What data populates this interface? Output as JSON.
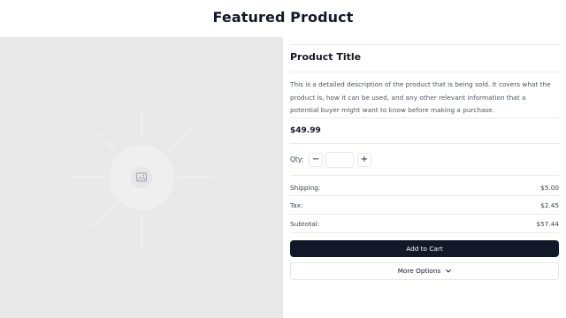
{
  "header": {
    "title": "Featured Product"
  },
  "product": {
    "title": "Product Title",
    "description": "This is a detailed description of the product that is being sold. It covers what the product is, how it can be used, and any other relevant information that a potential buyer might want to know before making a purchase.",
    "price": "$49.99"
  },
  "quantity": {
    "label": "Qty:",
    "decrement": "−",
    "increment": "+",
    "value": ""
  },
  "costs": [
    {
      "label": "Shipping:",
      "value": "$5.00"
    },
    {
      "label": "Tax:",
      "value": "$2.45"
    },
    {
      "label": "Subtotal:",
      "value": "$57.44"
    }
  ],
  "actions": {
    "add_to_cart": "Add to Cart",
    "more_options": "More Options"
  },
  "icons": {
    "image_placeholder": "image-icon",
    "more_options": "chevron-down-icon"
  },
  "colors": {
    "primary_button": "#111827",
    "image_background": "#e9e9e9"
  }
}
